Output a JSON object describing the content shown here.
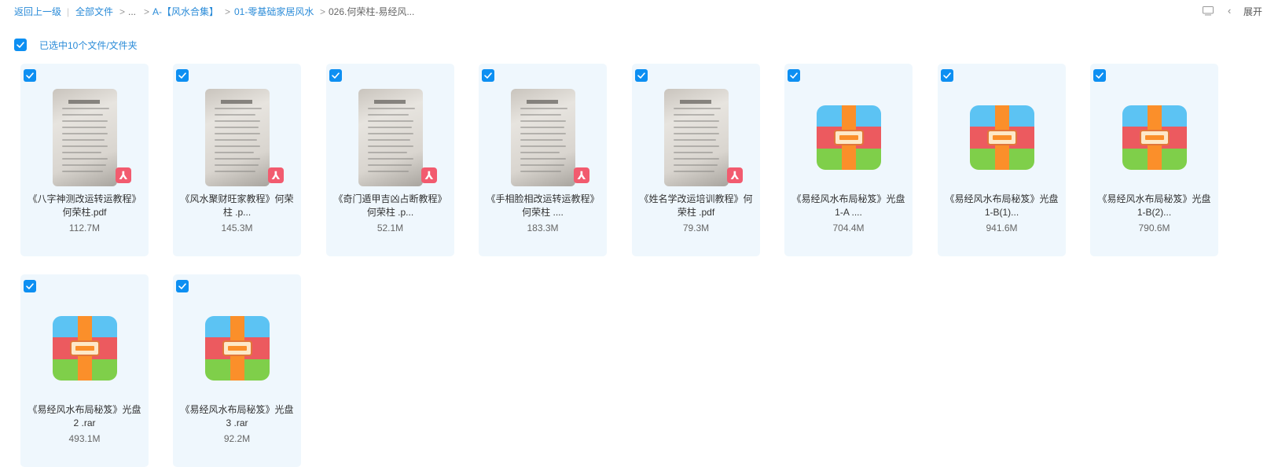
{
  "breadcrumb": {
    "back": "返回上一级",
    "pipe": "|",
    "all_files": "全部文件",
    "sep": ">",
    "ellipsis": "...",
    "crumb_a": "A-【风水合集】",
    "crumb_b": "01-零基础家居风水",
    "current": "026.何荣柱-易经风..."
  },
  "header": {
    "expand_chevron": "‹",
    "expand_label": "展开"
  },
  "selection": {
    "label": "已选中10个文件/文件夹"
  },
  "colors": {
    "accent": "#0d8ff2",
    "pdf_badge": "#f25b6f",
    "card_bg": "#eff7fd"
  },
  "files": [
    {
      "type": "pdf",
      "name_line1": "《八字神测改运转运教程》",
      "name_line2": "何荣柱.pdf",
      "size": "112.7M"
    },
    {
      "type": "pdf",
      "name_line1": "《风水聚财旺家教程》何荣",
      "name_line2": "柱 .p...",
      "size": "145.3M"
    },
    {
      "type": "pdf",
      "name_line1": "《奇门遁甲吉凶占断教程》",
      "name_line2": "何荣柱 .p...",
      "size": "52.1M"
    },
    {
      "type": "pdf",
      "name_line1": "《手相脸相改运转运教程》",
      "name_line2": "何荣柱 ....",
      "size": "183.3M"
    },
    {
      "type": "pdf",
      "name_line1": "《姓名学改运培训教程》何",
      "name_line2": "荣柱 .pdf",
      "size": "79.3M"
    },
    {
      "type": "rar",
      "name_line1": "《易经风水布局秘笈》光盘",
      "name_line2": "1-A ....",
      "size": "704.4M"
    },
    {
      "type": "rar",
      "name_line1": "《易经风水布局秘笈》光盘",
      "name_line2": "1-B(1)...",
      "size": "941.6M"
    },
    {
      "type": "rar",
      "name_line1": "《易经风水布局秘笈》光盘",
      "name_line2": "1-B(2)...",
      "size": "790.6M"
    },
    {
      "type": "rar",
      "name_line1": "《易经风水布局秘笈》光盘",
      "name_line2": "2 .rar",
      "size": "493.1M"
    },
    {
      "type": "rar",
      "name_line1": "《易经风水布局秘笈》光盘",
      "name_line2": "3 .rar",
      "size": "92.2M"
    }
  ]
}
